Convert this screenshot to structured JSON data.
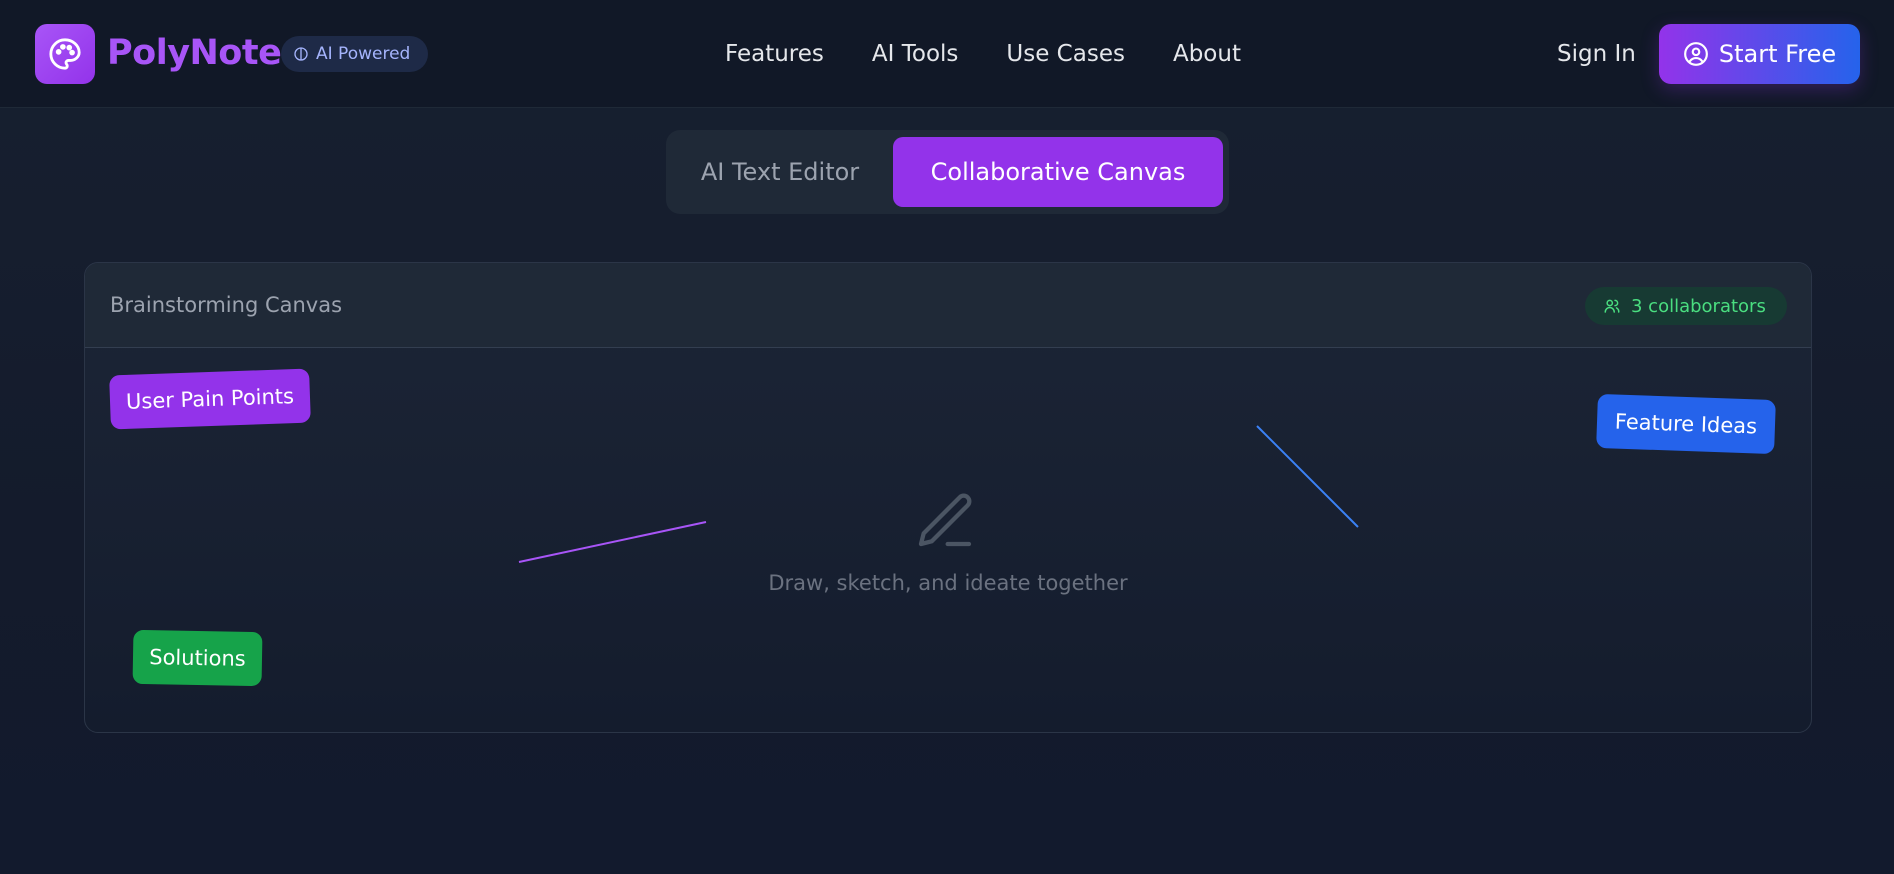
{
  "header": {
    "brand": "PolyNote",
    "badge": "AI Powered",
    "nav": [
      "Features",
      "AI Tools",
      "Use Cases",
      "About"
    ],
    "sign_in": "Sign In",
    "cta": "Start Free"
  },
  "tabs": {
    "items": [
      "AI Text Editor",
      "Collaborative Canvas"
    ],
    "active": "Collaborative Canvas"
  },
  "canvas": {
    "title": "Brainstorming Canvas",
    "collaborators": "3 collaborators",
    "notes": [
      {
        "label": "User Pain Points",
        "color": "#9333ea"
      },
      {
        "label": "Feature Ideas",
        "color": "#2563eb"
      },
      {
        "label": "Solutions",
        "color": "#16a34a"
      }
    ],
    "empty_message": "Draw, sketch, and ideate together"
  },
  "colors": {
    "accent": "#9333ea",
    "accent_blue": "#2563eb",
    "success": "#16a34a"
  }
}
